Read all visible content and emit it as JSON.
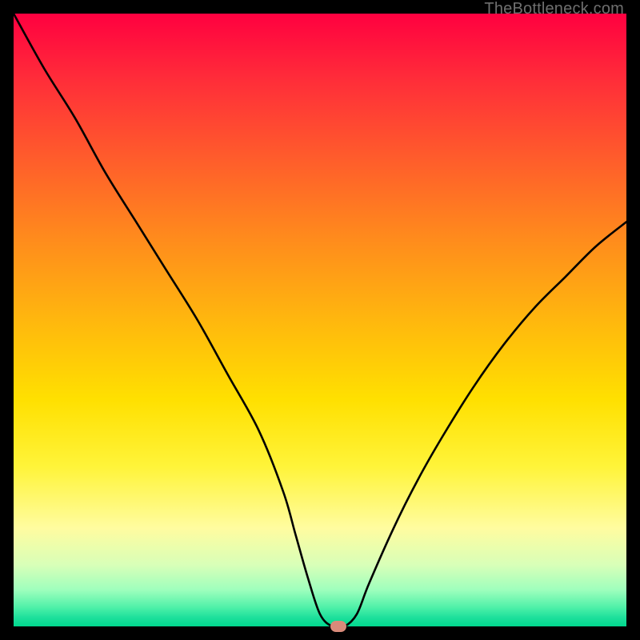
{
  "watermark": "TheBottleneck.com",
  "chart_data": {
    "type": "line",
    "title": "",
    "xlabel": "",
    "ylabel": "",
    "xlim": [
      0,
      100
    ],
    "ylim": [
      0,
      100
    ],
    "grid": false,
    "legend": false,
    "series": [
      {
        "name": "bottleneck-curve",
        "x": [
          0,
          5,
          10,
          15,
          20,
          25,
          30,
          35,
          40,
          44,
          46,
          48,
          50,
          52,
          54,
          56,
          58,
          62,
          66,
          70,
          75,
          80,
          85,
          90,
          95,
          100
        ],
        "values": [
          100,
          91,
          83,
          74,
          66,
          58,
          50,
          41,
          32,
          22,
          15,
          8,
          2,
          0,
          0,
          2,
          7,
          16,
          24,
          31,
          39,
          46,
          52,
          57,
          62,
          66
        ]
      }
    ],
    "marker": {
      "x": 53,
      "y": 0,
      "color": "#d98a7a"
    },
    "gradient_stops": [
      {
        "pos": 0.0,
        "color": "#ff0040"
      },
      {
        "pos": 0.11,
        "color": "#ff2e39"
      },
      {
        "pos": 0.23,
        "color": "#ff5a2c"
      },
      {
        "pos": 0.37,
        "color": "#ff8c1c"
      },
      {
        "pos": 0.5,
        "color": "#ffb70e"
      },
      {
        "pos": 0.63,
        "color": "#ffe000"
      },
      {
        "pos": 0.74,
        "color": "#fff43a"
      },
      {
        "pos": 0.84,
        "color": "#fffca0"
      },
      {
        "pos": 0.9,
        "color": "#d8ffb8"
      },
      {
        "pos": 0.94,
        "color": "#9fffbd"
      },
      {
        "pos": 0.97,
        "color": "#4cf0a8"
      },
      {
        "pos": 0.985,
        "color": "#1fe09c"
      },
      {
        "pos": 1.0,
        "color": "#00d88e"
      }
    ]
  }
}
